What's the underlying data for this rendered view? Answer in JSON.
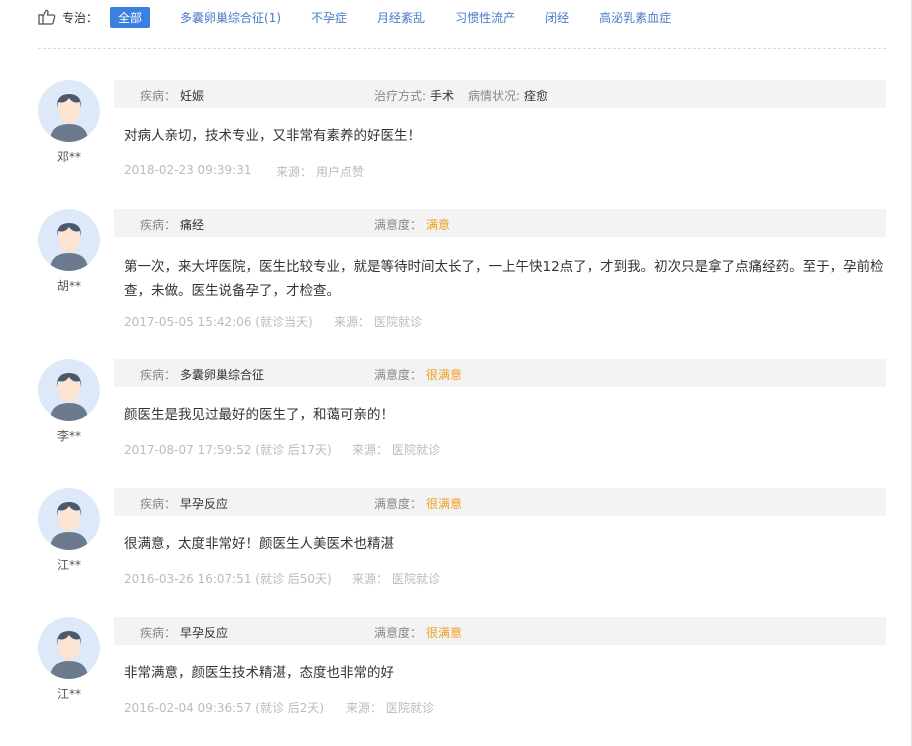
{
  "filter": {
    "label": "专治：",
    "tags": [
      {
        "label": "全部",
        "active": true
      },
      {
        "label": "多囊卵巢综合征(1)"
      },
      {
        "label": "不孕症"
      },
      {
        "label": "月经紊乱"
      },
      {
        "label": "习惯性流产"
      },
      {
        "label": "闭经"
      },
      {
        "label": "高泌乳素血症"
      }
    ]
  },
  "reviews": [
    {
      "user": "邓**",
      "disease_label": "疾病：",
      "disease": "妊娠",
      "treatment_label": "治疗方式:",
      "treatment": "手术",
      "status_label": "病情状况:",
      "status": "痊愈",
      "text": "对病人亲切，技术专业，又非常有素养的好医生！",
      "time": "2018-02-23 09:39:31",
      "source_label": "来源：",
      "source": "用户点赞"
    },
    {
      "user": "胡**",
      "disease_label": "疾病：",
      "disease": "痛经",
      "satisfaction_label": "满意度：",
      "satisfaction": "满意",
      "text": "第一次，来大坪医院，医生比较专业，就是等待时间太长了，一上午快12点了，才到我。初次只是拿了点痛经药。至于，孕前检查，未做。医生说备孕了，才检查。",
      "time": "2017-05-05 15:42:06 (就诊当天)",
      "source_label": "来源：",
      "source": "医院就诊"
    },
    {
      "user": "李**",
      "disease_label": "疾病：",
      "disease": "多囊卵巢综合征",
      "satisfaction_label": "满意度：",
      "satisfaction": "很满意",
      "text": "颜医生是我见过最好的医生了，和蔼可亲的！",
      "time": "2017-08-07 17:59:52 (就诊 后17天)",
      "source_label": "来源：",
      "source": "医院就诊"
    },
    {
      "user": "江**",
      "disease_label": "疾病：",
      "disease": "早孕反应",
      "satisfaction_label": "满意度：",
      "satisfaction": "很满意",
      "text": "很满意，太度非常好！颜医生人美医术也精湛",
      "time": "2016-03-26 16:07:51 (就诊 后50天)",
      "source_label": "来源：",
      "source": "医院就诊"
    },
    {
      "user": "江**",
      "disease_label": "疾病：",
      "disease": "早孕反应",
      "satisfaction_label": "满意度：",
      "satisfaction": "很满意",
      "text": "非常满意，颜医生技术精湛，态度也非常的好",
      "time": "2016-02-04 09:36:57 (就诊 后2天)",
      "source_label": "来源：",
      "source": "医院就诊"
    }
  ],
  "colors": {
    "accent": "#3b7fe0",
    "link": "#4a7bc8",
    "satisfaction": "#f0a020"
  }
}
